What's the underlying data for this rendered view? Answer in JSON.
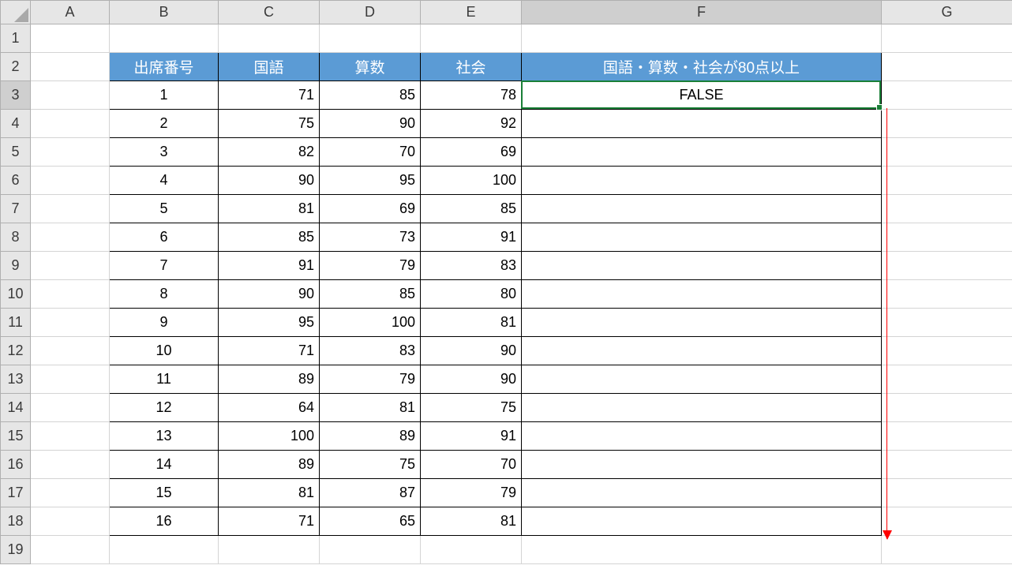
{
  "columns": [
    "A",
    "B",
    "C",
    "D",
    "E",
    "F",
    "G"
  ],
  "row_count": 19,
  "selected_column_index": 5,
  "selected_row_index": 2,
  "active_cell": "F3",
  "table": {
    "headers": {
      "B": "出席番号",
      "C": "国語",
      "D": "算数",
      "E": "社会",
      "F": "国語・算数・社会が80点以上"
    },
    "rows": [
      {
        "no": 1,
        "kokugo": 71,
        "sansu": 85,
        "shakai": 78,
        "result": "FALSE"
      },
      {
        "no": 2,
        "kokugo": 75,
        "sansu": 90,
        "shakai": 92,
        "result": ""
      },
      {
        "no": 3,
        "kokugo": 82,
        "sansu": 70,
        "shakai": 69,
        "result": ""
      },
      {
        "no": 4,
        "kokugo": 90,
        "sansu": 95,
        "shakai": 100,
        "result": ""
      },
      {
        "no": 5,
        "kokugo": 81,
        "sansu": 69,
        "shakai": 85,
        "result": ""
      },
      {
        "no": 6,
        "kokugo": 85,
        "sansu": 73,
        "shakai": 91,
        "result": ""
      },
      {
        "no": 7,
        "kokugo": 91,
        "sansu": 79,
        "shakai": 83,
        "result": ""
      },
      {
        "no": 8,
        "kokugo": 90,
        "sansu": 85,
        "shakai": 80,
        "result": ""
      },
      {
        "no": 9,
        "kokugo": 95,
        "sansu": 100,
        "shakai": 81,
        "result": ""
      },
      {
        "no": 10,
        "kokugo": 71,
        "sansu": 83,
        "shakai": 90,
        "result": ""
      },
      {
        "no": 11,
        "kokugo": 89,
        "sansu": 79,
        "shakai": 90,
        "result": ""
      },
      {
        "no": 12,
        "kokugo": 64,
        "sansu": 81,
        "shakai": 75,
        "result": ""
      },
      {
        "no": 13,
        "kokugo": 100,
        "sansu": 89,
        "shakai": 91,
        "result": ""
      },
      {
        "no": 14,
        "kokugo": 89,
        "sansu": 75,
        "shakai": 70,
        "result": ""
      },
      {
        "no": 15,
        "kokugo": 81,
        "sansu": 87,
        "shakai": 79,
        "result": ""
      },
      {
        "no": 16,
        "kokugo": 71,
        "sansu": 65,
        "shakai": 81,
        "result": ""
      }
    ]
  },
  "colors": {
    "header_bg": "#5b9bd5",
    "header_fg": "#ffffff",
    "selection_border": "#1a7f37",
    "arrow": "#ff0000"
  }
}
